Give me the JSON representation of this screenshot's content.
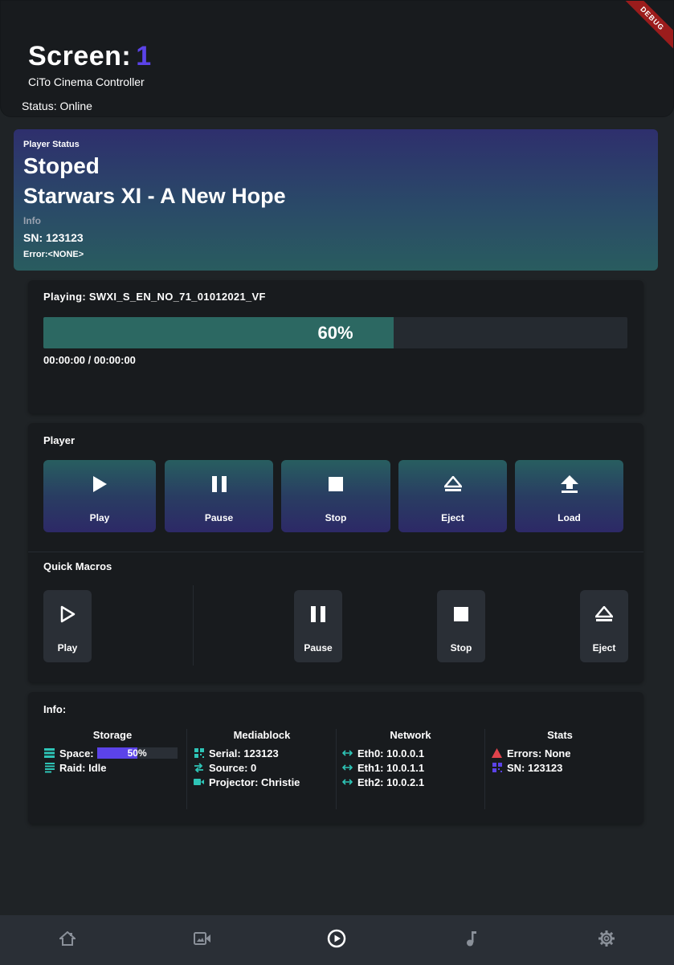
{
  "header": {
    "title": "Screen:",
    "screen_number": "1",
    "subtitle": "CiTo Cinema Controller",
    "status": "Status: Online",
    "debug_banner": "DEBUG"
  },
  "player_status": {
    "label": "Player Status",
    "state": "Stoped",
    "movie": "Starwars XI - A New Hope",
    "info_label": "Info",
    "sn": "SN: 123123",
    "error": "Error:<NONE>"
  },
  "playing": {
    "label": "Playing:",
    "file": "SWXI_S_EN_NO_71_01012021_VF",
    "progress": 0.6,
    "progress_text": "60%",
    "time": "00:00:00 / 00:00:00"
  },
  "player": {
    "label": "Player",
    "buttons": [
      {
        "label": "Play",
        "icon": "play-icon"
      },
      {
        "label": "Pause",
        "icon": "pause-icon"
      },
      {
        "label": "Stop",
        "icon": "stop-icon"
      },
      {
        "label": "Eject",
        "icon": "eject-icon"
      },
      {
        "label": "Load",
        "icon": "upload-icon"
      }
    ]
  },
  "macros": {
    "label": "Quick Macros",
    "buttons": [
      {
        "label": "Play",
        "icon": "play-outline-icon"
      },
      {
        "label": "Pause",
        "icon": "pause-icon"
      },
      {
        "label": "Stop",
        "icon": "stop-icon"
      },
      {
        "label": "Eject",
        "icon": "eject-icon"
      }
    ]
  },
  "info": {
    "label": "Info:",
    "storage": {
      "title": "Storage",
      "space_label": "Space:",
      "space_fraction": 0.5,
      "space_text": "50%",
      "raid": "Raid: Idle"
    },
    "mediablock": {
      "title": "Mediablock",
      "serial": "Serial: 123123",
      "source": "Source:  0",
      "projector": "Projector: Christie"
    },
    "network": {
      "title": "Network",
      "eth0": "Eth0: 10.0.0.1",
      "eth1": "Eth1: 10.0.1.1",
      "eth2": "Eth2: 10.0.2.1"
    },
    "stats": {
      "title": "Stats",
      "errors": "Errors: None",
      "sn": "SN: 123123"
    }
  },
  "nav": {
    "items": [
      "home-icon",
      "video-icon",
      "play-circle-icon",
      "music-note-icon",
      "settings-gear-icon"
    ],
    "active": "play-circle-icon"
  },
  "colors": {
    "accent": "#5b43e8",
    "teal": "#2c6862",
    "error_red": "#e0434c",
    "icon_teal": "#2ec4b6"
  }
}
